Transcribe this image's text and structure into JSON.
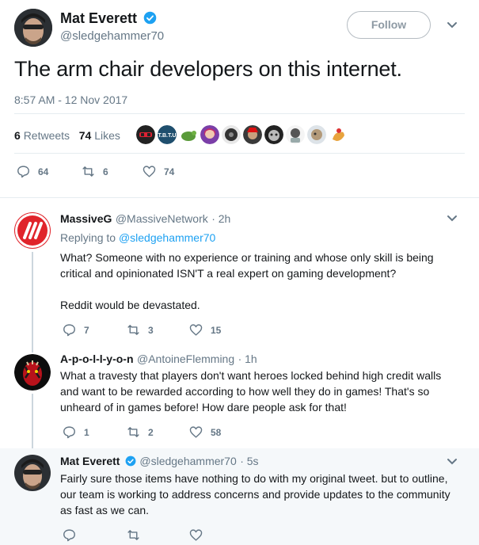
{
  "tweet": {
    "author_name": "Mat Everett",
    "author_handle": "@sledgehammer70",
    "follow_label": "Follow",
    "text": "The arm chair developers on this internet.",
    "timestamp": "8:57 AM - 12 Nov 2017",
    "retweets_count": "6",
    "retweets_label": "Retweets",
    "likes_count": "74",
    "likes_label": "Likes",
    "actions": {
      "replies": "64",
      "retweets": "6",
      "likes": "74"
    }
  },
  "replies": [
    {
      "name": "MassiveG",
      "handle": "@MassiveNetwork",
      "time": "· 2h",
      "replying_prefix": "Replying to",
      "replying_to": "@sledgehammer70",
      "text_1": "What?  Someone with no experience or training and whose only skill is being",
      "text_2": "critical and opinionated ISN'T a real expert on gaming development?",
      "text_3": "Reddit would be devastated.",
      "replies": "7",
      "retweets": "3",
      "likes": "15"
    },
    {
      "name": "A-p-o-l-l-y-o-n",
      "handle": "@AntoineFlemming",
      "time": "· 1h",
      "text_1": "What a travesty that players don't want heroes locked behind high credit walls",
      "text_2": "and want to be rewarded according to how well they do in games! That's so",
      "text_3": "unheard of in games before! How dare people ask for that!",
      "replies": "1",
      "retweets": "2",
      "likes": "58"
    },
    {
      "name": "Mat Everett",
      "handle": "@sledgehammer70",
      "time": "· 5s",
      "text_1": "Fairly sure those items have nothing to do with my original tweet. but to outline,",
      "text_2": "our team is working to address concerns and provide updates to the community",
      "text_3": "as fast as we can."
    }
  ],
  "colors": {
    "blue": "#1da1f2",
    "gray": "#657786",
    "red": "#e0242b",
    "highlight": "#f5f8fa"
  }
}
